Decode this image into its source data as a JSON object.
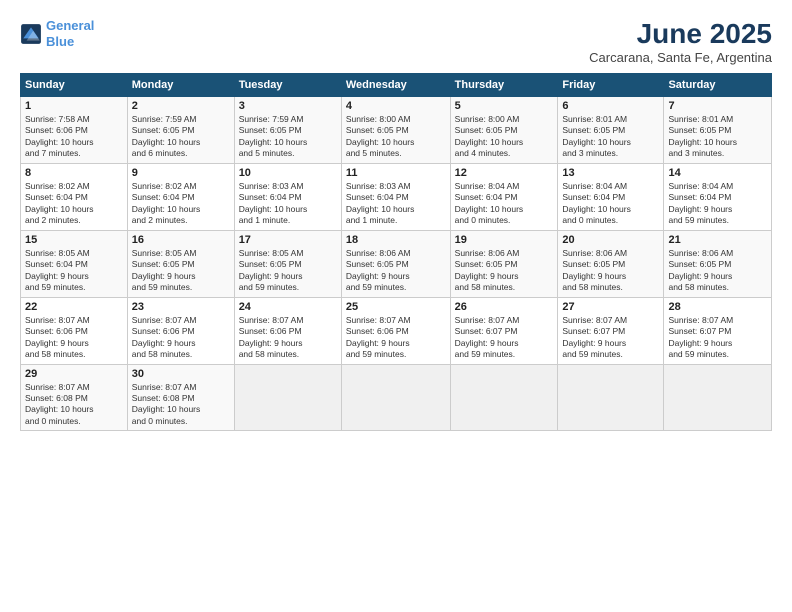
{
  "header": {
    "logo_line1": "General",
    "logo_line2": "Blue",
    "month": "June 2025",
    "location": "Carcarana, Santa Fe, Argentina"
  },
  "weekdays": [
    "Sunday",
    "Monday",
    "Tuesday",
    "Wednesday",
    "Thursday",
    "Friday",
    "Saturday"
  ],
  "weeks": [
    [
      {
        "day": "1",
        "detail": "Sunrise: 7:58 AM\nSunset: 6:06 PM\nDaylight: 10 hours\nand 7 minutes."
      },
      {
        "day": "2",
        "detail": "Sunrise: 7:59 AM\nSunset: 6:05 PM\nDaylight: 10 hours\nand 6 minutes."
      },
      {
        "day": "3",
        "detail": "Sunrise: 7:59 AM\nSunset: 6:05 PM\nDaylight: 10 hours\nand 5 minutes."
      },
      {
        "day": "4",
        "detail": "Sunrise: 8:00 AM\nSunset: 6:05 PM\nDaylight: 10 hours\nand 5 minutes."
      },
      {
        "day": "5",
        "detail": "Sunrise: 8:00 AM\nSunset: 6:05 PM\nDaylight: 10 hours\nand 4 minutes."
      },
      {
        "day": "6",
        "detail": "Sunrise: 8:01 AM\nSunset: 6:05 PM\nDaylight: 10 hours\nand 3 minutes."
      },
      {
        "day": "7",
        "detail": "Sunrise: 8:01 AM\nSunset: 6:05 PM\nDaylight: 10 hours\nand 3 minutes."
      }
    ],
    [
      {
        "day": "8",
        "detail": "Sunrise: 8:02 AM\nSunset: 6:04 PM\nDaylight: 10 hours\nand 2 minutes."
      },
      {
        "day": "9",
        "detail": "Sunrise: 8:02 AM\nSunset: 6:04 PM\nDaylight: 10 hours\nand 2 minutes."
      },
      {
        "day": "10",
        "detail": "Sunrise: 8:03 AM\nSunset: 6:04 PM\nDaylight: 10 hours\nand 1 minute."
      },
      {
        "day": "11",
        "detail": "Sunrise: 8:03 AM\nSunset: 6:04 PM\nDaylight: 10 hours\nand 1 minute."
      },
      {
        "day": "12",
        "detail": "Sunrise: 8:04 AM\nSunset: 6:04 PM\nDaylight: 10 hours\nand 0 minutes."
      },
      {
        "day": "13",
        "detail": "Sunrise: 8:04 AM\nSunset: 6:04 PM\nDaylight: 10 hours\nand 0 minutes."
      },
      {
        "day": "14",
        "detail": "Sunrise: 8:04 AM\nSunset: 6:04 PM\nDaylight: 9 hours\nand 59 minutes."
      }
    ],
    [
      {
        "day": "15",
        "detail": "Sunrise: 8:05 AM\nSunset: 6:04 PM\nDaylight: 9 hours\nand 59 minutes."
      },
      {
        "day": "16",
        "detail": "Sunrise: 8:05 AM\nSunset: 6:05 PM\nDaylight: 9 hours\nand 59 minutes."
      },
      {
        "day": "17",
        "detail": "Sunrise: 8:05 AM\nSunset: 6:05 PM\nDaylight: 9 hours\nand 59 minutes."
      },
      {
        "day": "18",
        "detail": "Sunrise: 8:06 AM\nSunset: 6:05 PM\nDaylight: 9 hours\nand 59 minutes."
      },
      {
        "day": "19",
        "detail": "Sunrise: 8:06 AM\nSunset: 6:05 PM\nDaylight: 9 hours\nand 58 minutes."
      },
      {
        "day": "20",
        "detail": "Sunrise: 8:06 AM\nSunset: 6:05 PM\nDaylight: 9 hours\nand 58 minutes."
      },
      {
        "day": "21",
        "detail": "Sunrise: 8:06 AM\nSunset: 6:05 PM\nDaylight: 9 hours\nand 58 minutes."
      }
    ],
    [
      {
        "day": "22",
        "detail": "Sunrise: 8:07 AM\nSunset: 6:06 PM\nDaylight: 9 hours\nand 58 minutes."
      },
      {
        "day": "23",
        "detail": "Sunrise: 8:07 AM\nSunset: 6:06 PM\nDaylight: 9 hours\nand 58 minutes."
      },
      {
        "day": "24",
        "detail": "Sunrise: 8:07 AM\nSunset: 6:06 PM\nDaylight: 9 hours\nand 58 minutes."
      },
      {
        "day": "25",
        "detail": "Sunrise: 8:07 AM\nSunset: 6:06 PM\nDaylight: 9 hours\nand 59 minutes."
      },
      {
        "day": "26",
        "detail": "Sunrise: 8:07 AM\nSunset: 6:07 PM\nDaylight: 9 hours\nand 59 minutes."
      },
      {
        "day": "27",
        "detail": "Sunrise: 8:07 AM\nSunset: 6:07 PM\nDaylight: 9 hours\nand 59 minutes."
      },
      {
        "day": "28",
        "detail": "Sunrise: 8:07 AM\nSunset: 6:07 PM\nDaylight: 9 hours\nand 59 minutes."
      }
    ],
    [
      {
        "day": "29",
        "detail": "Sunrise: 8:07 AM\nSunset: 6:08 PM\nDaylight: 10 hours\nand 0 minutes."
      },
      {
        "day": "30",
        "detail": "Sunrise: 8:07 AM\nSunset: 6:08 PM\nDaylight: 10 hours\nand 0 minutes."
      },
      {
        "day": "",
        "detail": ""
      },
      {
        "day": "",
        "detail": ""
      },
      {
        "day": "",
        "detail": ""
      },
      {
        "day": "",
        "detail": ""
      },
      {
        "day": "",
        "detail": ""
      }
    ]
  ]
}
